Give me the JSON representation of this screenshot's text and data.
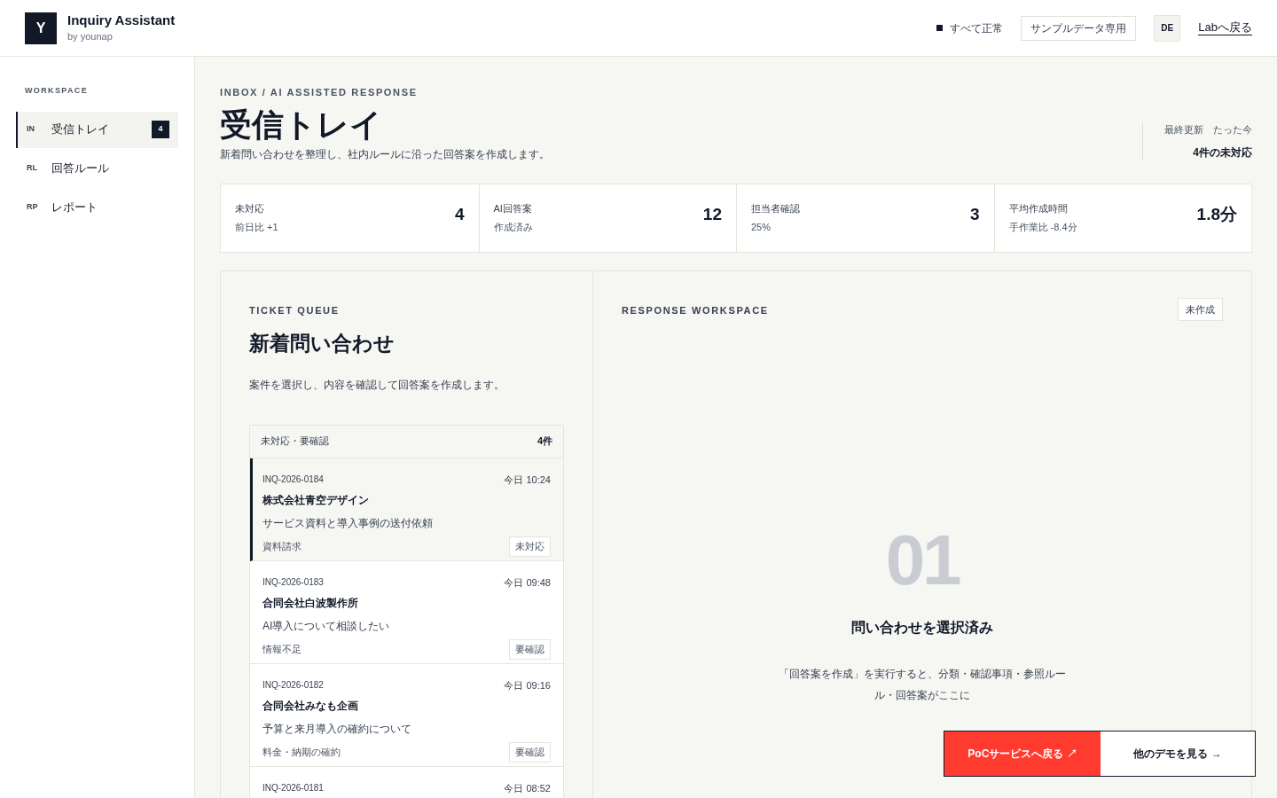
{
  "app": {
    "logo": "Y",
    "title": "Inquiry Assistant",
    "subtitle": "by younap"
  },
  "header": {
    "status": "すべて正常",
    "sample_badge": "サンプルデータ専用",
    "user": "DE",
    "back_link": "Labへ戻る"
  },
  "sidebar": {
    "heading": "WORKSPACE",
    "items": [
      {
        "code": "IN",
        "label": "受信トレイ",
        "count": "4",
        "selected": true
      },
      {
        "code": "RL",
        "label": "回答ルール",
        "selected": false
      },
      {
        "code": "RP",
        "label": "レポート",
        "selected": false
      }
    ]
  },
  "page": {
    "eyebrow": "INBOX / AI ASSISTED RESPONSE",
    "title": "受信トレイ",
    "description": "新着問い合わせを整理し、社内ルールに沿った回答案を作成します。",
    "updated_label": "最終更新",
    "updated_value": "たった今",
    "pending": "4件の未対応"
  },
  "stats": [
    {
      "label": "未対応",
      "sub": "前日比 +1",
      "value": "4"
    },
    {
      "label": "AI回答案",
      "sub": "作成済み",
      "value": "12"
    },
    {
      "label": "担当者確認",
      "sub": "25%",
      "value": "3"
    },
    {
      "label": "平均作成時間",
      "sub": "手作業比 -8.4分",
      "value": "1.8分"
    }
  ],
  "queue": {
    "eyebrow": "TICKET QUEUE",
    "title": "新着問い合わせ",
    "description": "案件を選択し、内容を確認して回答案を作成します。",
    "list_label": "未対応・要確認",
    "list_count": "4件",
    "tickets": [
      {
        "id": "INQ-2026-0184",
        "time": "今日 10:24",
        "company": "株式会社青空デザイン",
        "subject": "サービス資料と導入事例の送付依頼",
        "tag": "資料請求",
        "status": "未対応",
        "selected": true
      },
      {
        "id": "INQ-2026-0183",
        "time": "今日 09:48",
        "company": "合同会社白波製作所",
        "subject": "AI導入について相談したい",
        "tag": "情報不足",
        "status": "要確認",
        "selected": false
      },
      {
        "id": "INQ-2026-0182",
        "time": "今日 09:16",
        "company": "合同会社みなも企画",
        "subject": "予算と来月導入の確約について",
        "tag": "料金・納期の確約",
        "status": "要確認",
        "selected": false
      },
      {
        "id": "INQ-2026-0181",
        "time": "今日 08:52",
        "selected": false
      }
    ]
  },
  "workspace": {
    "eyebrow": "RESPONSE WORKSPACE",
    "badge": "未作成",
    "step": "01",
    "empty_title": "問い合わせを選択済み",
    "empty_text": "「回答案を作成」を実行すると、分類・確認事項・参照ルール・回答案がここに"
  },
  "floating": {
    "primary": "PoCサービスへ戻る ↗",
    "secondary": "他のデモを見る →"
  }
}
